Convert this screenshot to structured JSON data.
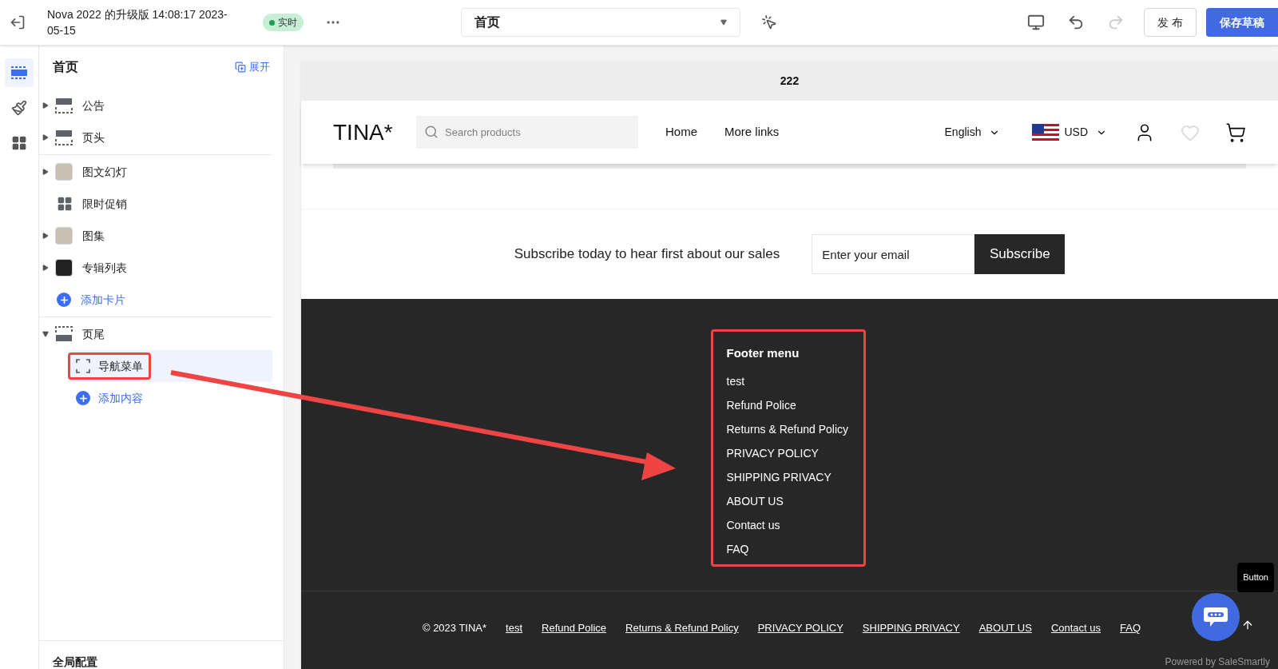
{
  "topbar": {
    "title": "Nova 2022 的升级版 14:08:17 2023-05-15",
    "status": "实时",
    "page_select": "首页",
    "publish": "发 布",
    "save": "保存草稿"
  },
  "rail": [
    {
      "kind": "sections",
      "selected": true
    },
    {
      "kind": "theme",
      "selected": false
    },
    {
      "kind": "apps",
      "selected": false
    }
  ],
  "sidebar": {
    "title": "首页",
    "expand": "展开",
    "groups": [
      [
        {
          "label": "公告",
          "kind": "layout",
          "expanded": false
        },
        {
          "label": "页头",
          "kind": "layout",
          "expanded": false
        }
      ],
      [
        {
          "label": "图文幻灯",
          "kind": "photo",
          "expanded": false
        },
        {
          "label": "限时促销",
          "kind": "grid"
        },
        {
          "label": "图集",
          "kind": "photo",
          "expanded": false
        },
        {
          "label": "专辑列表",
          "kind": "shirt",
          "expanded": false
        },
        {
          "label": "添加卡片",
          "kind": "add"
        }
      ],
      [
        {
          "label": "页尾",
          "kind": "footer",
          "expanded": true,
          "children": [
            {
              "label": "导航菜单",
              "kind": "block",
              "selected": true
            },
            {
              "label": "添加内容",
              "kind": "add",
              "selected": false
            }
          ]
        }
      ]
    ],
    "footer_label": "全局配置"
  },
  "preview": {
    "announcement": "222",
    "logo": "TINA*",
    "search": {
      "placeholder": "Search products"
    },
    "nav": [
      "Home",
      "More links"
    ],
    "language": "English",
    "currency": "USD",
    "subscribe": {
      "text": "Subscribe today to hear first about our sales",
      "placeholder": "Enter your email",
      "button": "Subscribe"
    },
    "footer_menu": {
      "title": "Footer menu",
      "links": [
        "test",
        "Refund Police",
        "Returns & Refund Policy",
        "PRIVACY POLICY",
        "SHIPPING PRIVACY",
        "ABOUT US",
        "Contact us",
        "FAQ"
      ]
    },
    "copyright": "© 2023 TINA*",
    "bottom_links": [
      "test",
      "Refund Police",
      "Returns & Refund Policy",
      "PRIVACY POLICY",
      "SHIPPING PRIVACY",
      "ABOUT US",
      "Contact us",
      "FAQ"
    ],
    "tooltip": "Button",
    "powered_by": "Powered by SaleSmartly"
  }
}
